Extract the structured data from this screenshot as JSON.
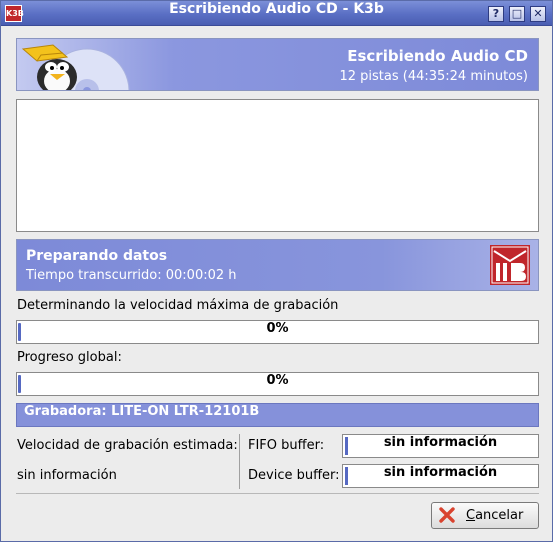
{
  "window": {
    "title": "Escribiendo Audio CD - K3b",
    "app_icon": "k3b-icon",
    "buttons": {
      "help": "?",
      "maximize": "□",
      "close": "✕"
    }
  },
  "header": {
    "title": "Escribiendo Audio CD",
    "subtitle": "12 pistas (44:35:24 minutos)"
  },
  "status": {
    "title": "Preparando datos",
    "elapsed": "Tiempo transcurrido: 00:00:02 h"
  },
  "progress": {
    "speed_label": "Determinando la velocidad máxima de grabación",
    "speed_value": "0%",
    "speed_fraction": 0.0,
    "global_label": "Progreso global:",
    "global_value": "0%",
    "global_fraction": 0.0
  },
  "writer": {
    "label": "Grabadora: LITE-ON LTR-12101B"
  },
  "speed_estimate": {
    "label": "Velocidad de grabación estimada:",
    "value": "sin información"
  },
  "buffers": {
    "fifo_label": "FIFO buffer:",
    "fifo_value": "sin información",
    "device_label": "Device buffer:",
    "device_value": "sin información"
  },
  "actions": {
    "cancel_prefix": "",
    "cancel_mnemonic": "C",
    "cancel_rest": "ancelar"
  },
  "colors": {
    "accent": "#7d8ad8",
    "progress": "#5669c2",
    "cancel_icon": "#d9432f"
  }
}
